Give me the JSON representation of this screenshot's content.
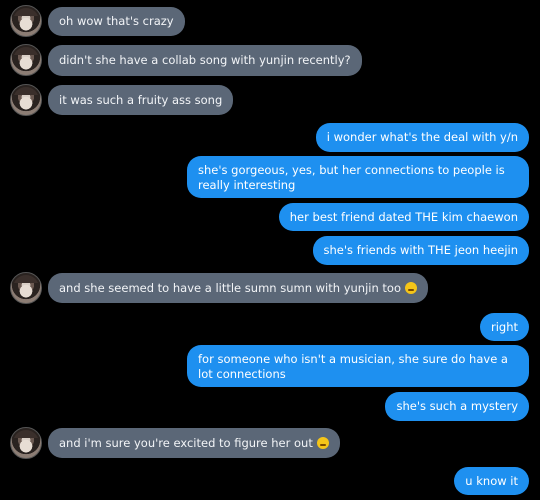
{
  "conversation": {
    "messages": [
      {
        "side": "them",
        "text": "oh wow that's crazy"
      },
      {
        "side": "them",
        "text": "didn't she have a collab song with yunjin recently?"
      },
      {
        "side": "them",
        "text": "it was such a fruity ass song"
      },
      {
        "side": "me",
        "text": "i wonder what's the deal with y/n"
      },
      {
        "side": "me",
        "text": "she's gorgeous, yes, but her connections to people is really interesting"
      },
      {
        "side": "me",
        "text": "her best friend dated THE kim chaewon"
      },
      {
        "side": "me",
        "text": "she's friends with THE jeon heejin"
      },
      {
        "side": "them",
        "text": "and she seemed to have a little sumn sumn with yunjin too",
        "emoji": "shushing-face-emoji"
      },
      {
        "side": "me",
        "text": "right"
      },
      {
        "side": "me",
        "text": "for someone who isn't a musician, she sure do have a lot connections"
      },
      {
        "side": "me",
        "text": "she's such a mystery"
      },
      {
        "side": "them",
        "text": "and i'm sure you're excited to figure her out",
        "emoji": "shushing-face-emoji"
      },
      {
        "side": "me",
        "text": "u know it"
      }
    ]
  },
  "colors": {
    "background": "#000000",
    "incoming_bubble": "#5b6777",
    "outgoing_bubble": "#1e90f0"
  }
}
